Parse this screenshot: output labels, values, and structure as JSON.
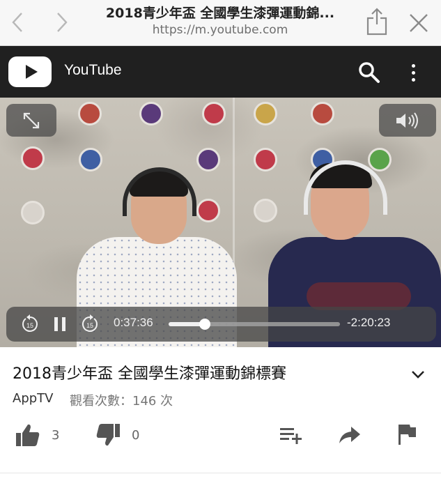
{
  "browser": {
    "page_title": "2018青少年盃 全國學生漆彈運動錦...",
    "url": "https://m.youtube.com",
    "icons": {
      "back": "chevron-left-icon",
      "forward": "chevron-right-icon",
      "share": "share-icon",
      "close": "close-icon"
    }
  },
  "youtube_header": {
    "wordmark": "YouTube",
    "icons": {
      "logo": "youtube-play-icon",
      "search": "search-icon",
      "more": "more-vertical-icon"
    }
  },
  "player": {
    "current_time": "0:37:36",
    "remaining_time": "-2:20:23",
    "progress_fraction": 0.21,
    "skip_back_seconds": "15",
    "skip_forward_seconds": "15",
    "state": "playing",
    "icons": {
      "fullscreen": "fullscreen-icon",
      "volume": "volume-icon",
      "skip_back": "skip-back-15-icon",
      "pause": "pause-icon",
      "skip_forward": "skip-forward-15-icon"
    }
  },
  "video_info": {
    "title": "2018青少年盃 全國學生漆彈運動錦標賽",
    "channel": "AppTV",
    "views": "觀看次數：146 次",
    "likes": "3",
    "dislikes": "0",
    "icons": {
      "expand": "chevron-down-icon",
      "like": "thumbs-up-icon",
      "dislike": "thumbs-down-icon",
      "add_to": "playlist-add-icon",
      "share": "share-arrow-icon",
      "flag": "flag-icon"
    }
  },
  "colors": {
    "youtube_header_bg": "#202020",
    "browser_bar_bg": "#f7f7f7",
    "icon_gray": "#9a9a9a",
    "action_icon": "#555555"
  }
}
